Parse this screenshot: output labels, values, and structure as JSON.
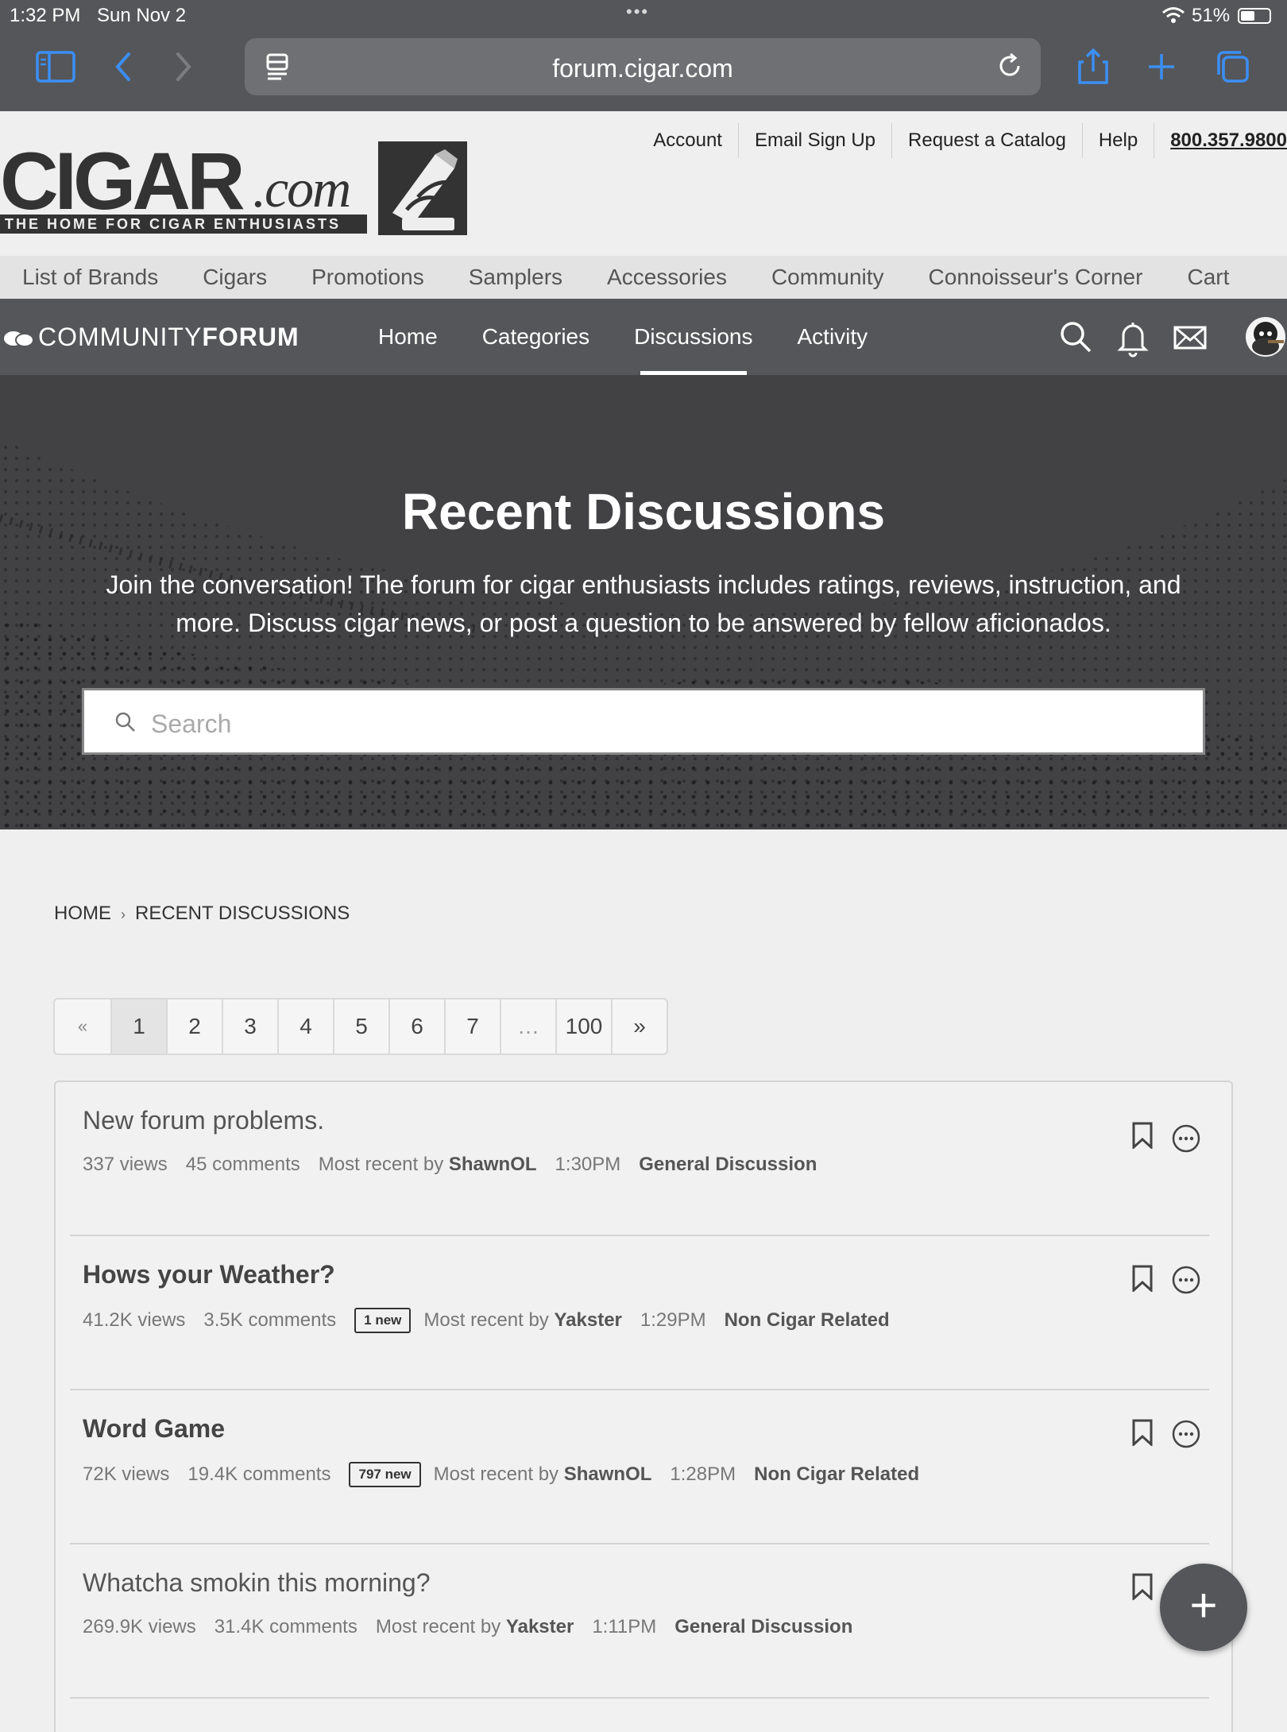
{
  "status_bar": {
    "time": "1:32 PM",
    "date": "Sun Nov 2",
    "battery": "51%"
  },
  "browser": {
    "url": "forum.cigar.com"
  },
  "top_links": {
    "account": "Account",
    "email_signup": "Email Sign Up",
    "request_catalog": "Request a Catalog",
    "help": "Help",
    "phone": "800.357.9800"
  },
  "logo": {
    "wordmark": "CIGAR",
    "suffix": ".com",
    "tagline": "THE HOME FOR CIGAR ENTHUSIASTS"
  },
  "main_nav": [
    "List of Brands",
    "Cigars",
    "Promotions",
    "Samplers",
    "Accessories",
    "Community",
    "Connoisseur's Corner",
    "Cart"
  ],
  "forum_nav": {
    "logo_light": "COMMUNITY",
    "logo_bold": "FORUM",
    "items": [
      "Home",
      "Categories",
      "Discussions",
      "Activity"
    ],
    "active": "Discussions"
  },
  "hero": {
    "title": "Recent Discussions",
    "description": "Join the conversation! The forum for cigar enthusiasts includes ratings, reviews, instruction, and more. Discuss cigar news, or post a question to be answered by fellow aficionados.",
    "search_placeholder": "Search"
  },
  "breadcrumb": {
    "home": "HOME",
    "current": "RECENT DISCUSSIONS",
    "separator": "›"
  },
  "pager": {
    "prev": "«",
    "pages": [
      "1",
      "2",
      "3",
      "4",
      "5",
      "6",
      "7"
    ],
    "ellipsis": "…",
    "last": "100",
    "next": "»",
    "current": "1"
  },
  "discussions": [
    {
      "title": "New forum problems.",
      "views": "337 views",
      "comments": "45 comments",
      "new_badge": "",
      "most_recent_label": "Most recent by",
      "user": "ShawnOL",
      "time": "1:30PM",
      "category": "General Discussion",
      "unread": false
    },
    {
      "title": "Hows your Weather?",
      "views": "41.2K views",
      "comments": "3.5K comments",
      "new_badge": "1 new",
      "most_recent_label": "Most recent by",
      "user": "Yakster",
      "time": "1:29PM",
      "category": "Non Cigar Related",
      "unread": true
    },
    {
      "title": "Word Game",
      "views": "72K views",
      "comments": "19.4K comments",
      "new_badge": "797 new",
      "most_recent_label": "Most recent by",
      "user": "ShawnOL",
      "time": "1:28PM",
      "category": "Non Cigar Related",
      "unread": true
    },
    {
      "title": "Whatcha smokin this morning?",
      "views": "269.9K views",
      "comments": "31.4K comments",
      "new_badge": "",
      "most_recent_label": "Most recent by",
      "user": "Yakster",
      "time": "1:11PM",
      "category": "General Discussion",
      "unread": false
    }
  ],
  "fab": {
    "label": "+"
  },
  "colors": {
    "chrome": "#555659",
    "accent": "#3b8ff5",
    "background": "#efefef"
  }
}
